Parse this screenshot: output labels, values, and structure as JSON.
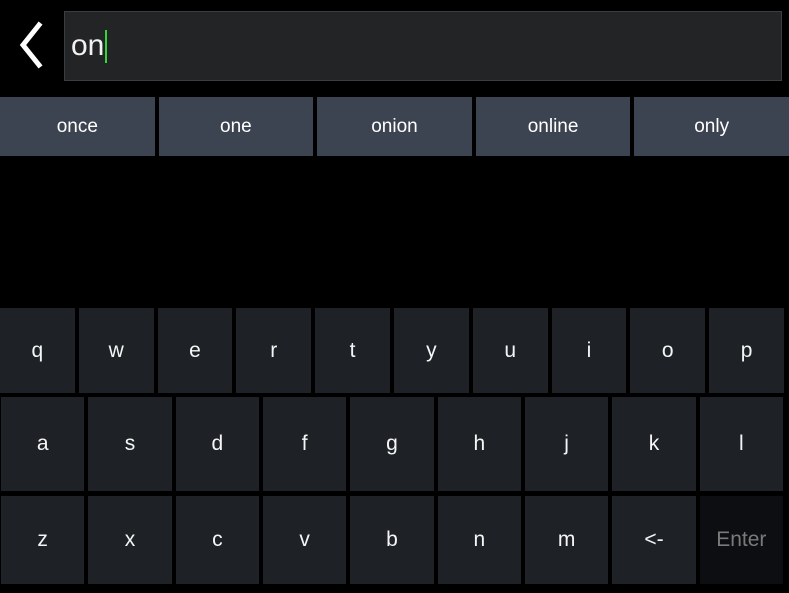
{
  "nav": {
    "back_icon": "chevron-left-icon",
    "back_label": "Back"
  },
  "search": {
    "value": "on",
    "placeholder": "",
    "caret_color": "#35d63a",
    "field_bg": "#222426",
    "field_border": "#3a3d41"
  },
  "suggestions": {
    "accent": "#3d4451",
    "items": [
      {
        "label": "once"
      },
      {
        "label": "one"
      },
      {
        "label": "onion"
      },
      {
        "label": "online"
      },
      {
        "label": "only"
      }
    ]
  },
  "keyboard": {
    "key_bg": "#1e2227",
    "key_text": "#f5f5f5",
    "disabled_bg": "#0c0e11",
    "disabled_text": "#7a7a7a",
    "rows": [
      {
        "keys": [
          {
            "label": "q",
            "name": "key-q",
            "state": "enabled"
          },
          {
            "label": "w",
            "name": "key-w",
            "state": "enabled"
          },
          {
            "label": "e",
            "name": "key-e",
            "state": "enabled"
          },
          {
            "label": "r",
            "name": "key-r",
            "state": "enabled"
          },
          {
            "label": "t",
            "name": "key-t",
            "state": "enabled"
          },
          {
            "label": "y",
            "name": "key-y",
            "state": "enabled"
          },
          {
            "label": "u",
            "name": "key-u",
            "state": "enabled"
          },
          {
            "label": "i",
            "name": "key-i",
            "state": "enabled"
          },
          {
            "label": "o",
            "name": "key-o",
            "state": "enabled"
          },
          {
            "label": "p",
            "name": "key-p",
            "state": "enabled"
          }
        ]
      },
      {
        "keys": [
          {
            "label": "a",
            "name": "key-a",
            "state": "enabled"
          },
          {
            "label": "s",
            "name": "key-s",
            "state": "enabled"
          },
          {
            "label": "d",
            "name": "key-d",
            "state": "enabled"
          },
          {
            "label": "f",
            "name": "key-f",
            "state": "enabled"
          },
          {
            "label": "g",
            "name": "key-g",
            "state": "enabled"
          },
          {
            "label": "h",
            "name": "key-h",
            "state": "enabled"
          },
          {
            "label": "j",
            "name": "key-j",
            "state": "enabled"
          },
          {
            "label": "k",
            "name": "key-k",
            "state": "enabled"
          },
          {
            "label": "l",
            "name": "key-l",
            "state": "enabled"
          }
        ]
      },
      {
        "keys": [
          {
            "label": "z",
            "name": "key-z",
            "state": "enabled"
          },
          {
            "label": "x",
            "name": "key-x",
            "state": "enabled"
          },
          {
            "label": "c",
            "name": "key-c",
            "state": "enabled"
          },
          {
            "label": "v",
            "name": "key-v",
            "state": "enabled"
          },
          {
            "label": "b",
            "name": "key-b",
            "state": "enabled"
          },
          {
            "label": "n",
            "name": "key-n",
            "state": "enabled"
          },
          {
            "label": "m",
            "name": "key-m",
            "state": "enabled"
          },
          {
            "label": "<-",
            "name": "key-backspace",
            "state": "enabled"
          },
          {
            "label": "Enter",
            "name": "key-enter",
            "state": "disabled"
          }
        ]
      }
    ]
  }
}
